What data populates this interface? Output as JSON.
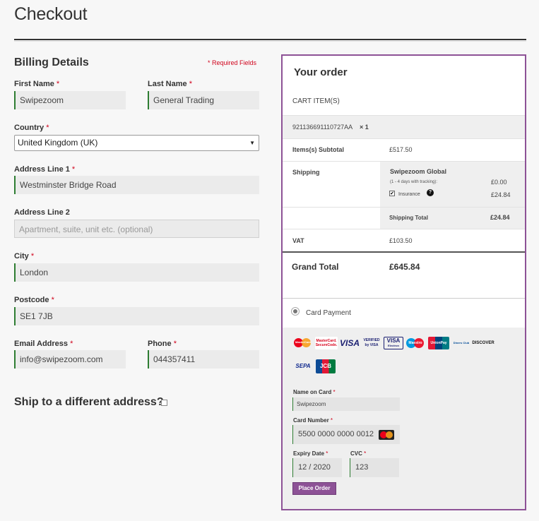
{
  "page": {
    "title": "Checkout"
  },
  "billing": {
    "heading": "Billing Details",
    "required_note": "* Required Fields",
    "first_name": {
      "label": "First Name",
      "value": "Swipezoom"
    },
    "last_name": {
      "label": "Last Name",
      "value": "General Trading"
    },
    "country": {
      "label": "Country",
      "value": "United Kingdom (UK)"
    },
    "address1": {
      "label": "Address Line 1",
      "value": "Westminster Bridge Road"
    },
    "address2": {
      "label": "Address Line 2",
      "placeholder": "Apartment, suite, unit etc. (optional)"
    },
    "city": {
      "label": "City",
      "value": "London"
    },
    "postcode": {
      "label": "Postcode",
      "value": "SE1 7JB"
    },
    "email": {
      "label": "Email Address",
      "value": "info@swipezoom.com"
    },
    "phone": {
      "label": "Phone",
      "value": "044357411"
    },
    "required_star": "*"
  },
  "ship_different": {
    "label": "Ship to a different address?"
  },
  "order": {
    "title": "Your order",
    "cart_header": "CART ITEM(S)",
    "item": {
      "name": "921136691110727AA",
      "qty": "× 1"
    },
    "subtotal": {
      "label": "Items(s) Subtotal",
      "value": "£517.50"
    },
    "shipping": {
      "label": "Shipping",
      "method": "Swipezoom Global",
      "method_note": "(1 - 4 days with tracking):",
      "method_price": "£0.00",
      "insurance_label": "Insurance",
      "insurance_price": "£24.84",
      "insurance_checked": "✔",
      "help_icon": "?",
      "total_label": "Shipping Total",
      "total_value": "£24.84"
    },
    "vat": {
      "label": "VAT",
      "value": "£103.50"
    },
    "grand_total": {
      "label": "Grand Total",
      "value": "£645.84"
    }
  },
  "payment": {
    "method_label": "Card Payment",
    "card_logos": [
      "mastercard",
      "mastercard-securecode",
      "visa",
      "verified-by-visa",
      "visa-electron",
      "maestro",
      "unionpay",
      "diners-club",
      "discover",
      "sepa",
      "jcb"
    ],
    "logo_text": {
      "mc_secure": "MasterCard. SecureCode.",
      "mastercard": "MasterCard",
      "visa": "VISA",
      "verified_top": "VERIFIED",
      "verified_bottom": "by VISA",
      "visa_electron": "VISA",
      "visa_electron_sub": "Electron",
      "maestro": "Maestro",
      "unionpay": "UnionPay",
      "diners": "Diners Club",
      "discover": "DISCOVER",
      "sepa": "SEPA",
      "jcb": "JCB"
    },
    "name_on_card": {
      "label": "Name on Card",
      "value": "Swipezoom"
    },
    "card_number": {
      "label": "Card Number",
      "value": "5500 0000 0000 0012"
    },
    "expiry": {
      "label": "Expiry Date",
      "value": "12 / 2020"
    },
    "cvc": {
      "label": "CVC",
      "value": "123"
    },
    "place_order": "Place Order"
  },
  "colors": {
    "accent": "#8d5296",
    "field_border": "#2e7d32",
    "required": "#d0021b"
  }
}
